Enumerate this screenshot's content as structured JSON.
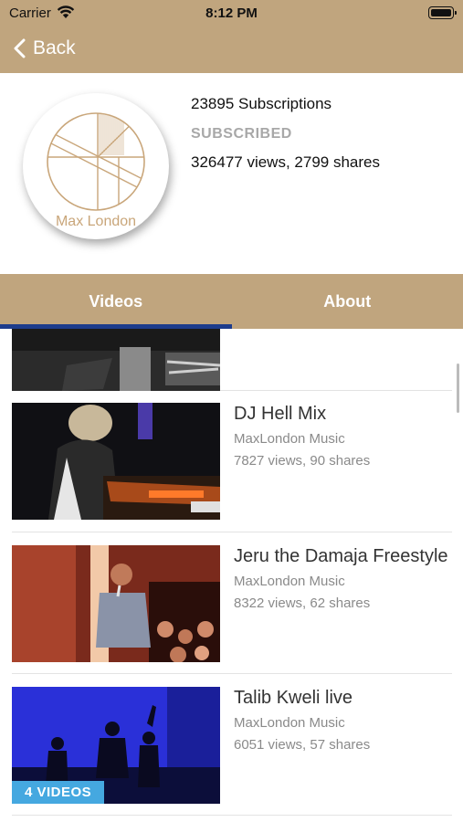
{
  "status_bar": {
    "carrier": "Carrier",
    "time": "8:12 PM"
  },
  "nav": {
    "back_label": "Back"
  },
  "channel": {
    "logo_text": "Max London",
    "subscriptions": "23895 Subscriptions",
    "subscribe_state": "SUBSCRIBED",
    "views_shares": "326477 views, 2799 shares"
  },
  "tabs": [
    {
      "label": "Videos",
      "active": true
    },
    {
      "label": "About",
      "active": false
    }
  ],
  "videos": [
    {
      "title": "DJ Hell Mix",
      "channel": "MaxLondon Music",
      "counts": "7827 views, 90 shares"
    },
    {
      "title": "Jeru the Damaja Freestyle",
      "channel": "MaxLondon Music",
      "counts": "8322 views, 62 shares"
    },
    {
      "title": "Talib Kweli live",
      "channel": "MaxLondon Music",
      "counts": "6051 views, 57 shares",
      "badge": "4 VIDEOS"
    }
  ],
  "colors": {
    "nav": "#c0a57e",
    "tab_indicator": "#1d3c8c",
    "badge": "#45a8e0",
    "logo": "#c9a67a"
  },
  "icons": {
    "back": "chevron-left-icon",
    "wifi": "wifi-icon",
    "battery": "battery-icon"
  }
}
